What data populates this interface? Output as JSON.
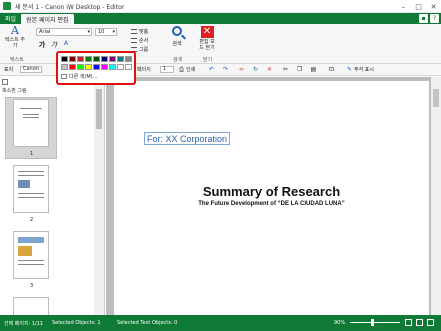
{
  "window": {
    "title": "새 문서 1 - Canon iW Desktop - Editor"
  },
  "tabs": [
    {
      "label": "파일"
    },
    {
      "label": "원본 페이지 편집"
    }
  ],
  "ribbon": {
    "text_button": {
      "glyph": "A",
      "label": "텍스트 추가"
    },
    "font_name": "Arial",
    "font_size": "10",
    "format_glyphs": [
      "가",
      "가",
      "A"
    ],
    "group_text_label": "텍스트",
    "align_items": [
      "맞춤",
      "순서",
      "그룹"
    ],
    "search_label": "검색",
    "group_search_label": "검색",
    "close_label": "편집 모드 닫기",
    "group_close_label": "닫기"
  },
  "palette": {
    "row1": [
      "#000000",
      "#7f0000",
      "#cc2222",
      "#007f00",
      "#005500",
      "#00007f",
      "#7f007f",
      "#007f7f",
      "#888888"
    ],
    "row2": [
      "#c0c0c0",
      "#ff0000",
      "#00ff00",
      "#ffff00",
      "#0000ff",
      "#ff00ff",
      "#00ffff",
      "#ffffff",
      "#ffffff"
    ],
    "more_label": "다른 색(M)..."
  },
  "toolbar2": {
    "stamp_label": "표지",
    "combo_prefix": "Canon",
    "page_prefix": "페이지",
    "page_value": "1",
    "print_label": "인쇄",
    "annotation_label": "주석 표시"
  },
  "thumbnails": {
    "title": "축소판 그림",
    "pages": [
      "1",
      "2",
      "3"
    ]
  },
  "document": {
    "for_text": "For: XX Corporation",
    "title": "Summary of Research",
    "subtitle": "The Future Development of “DE LA CIUDAD LUNA”"
  },
  "status": {
    "page": "선택 페이지: 1/11",
    "selected_objects": "Selected Objects: 1",
    "selected_text_objects": "Selected Text Objects: 0",
    "zoom": "90%"
  },
  "colors": {
    "brand_green": "#0f7a35",
    "highlight_red": "#e01010"
  }
}
